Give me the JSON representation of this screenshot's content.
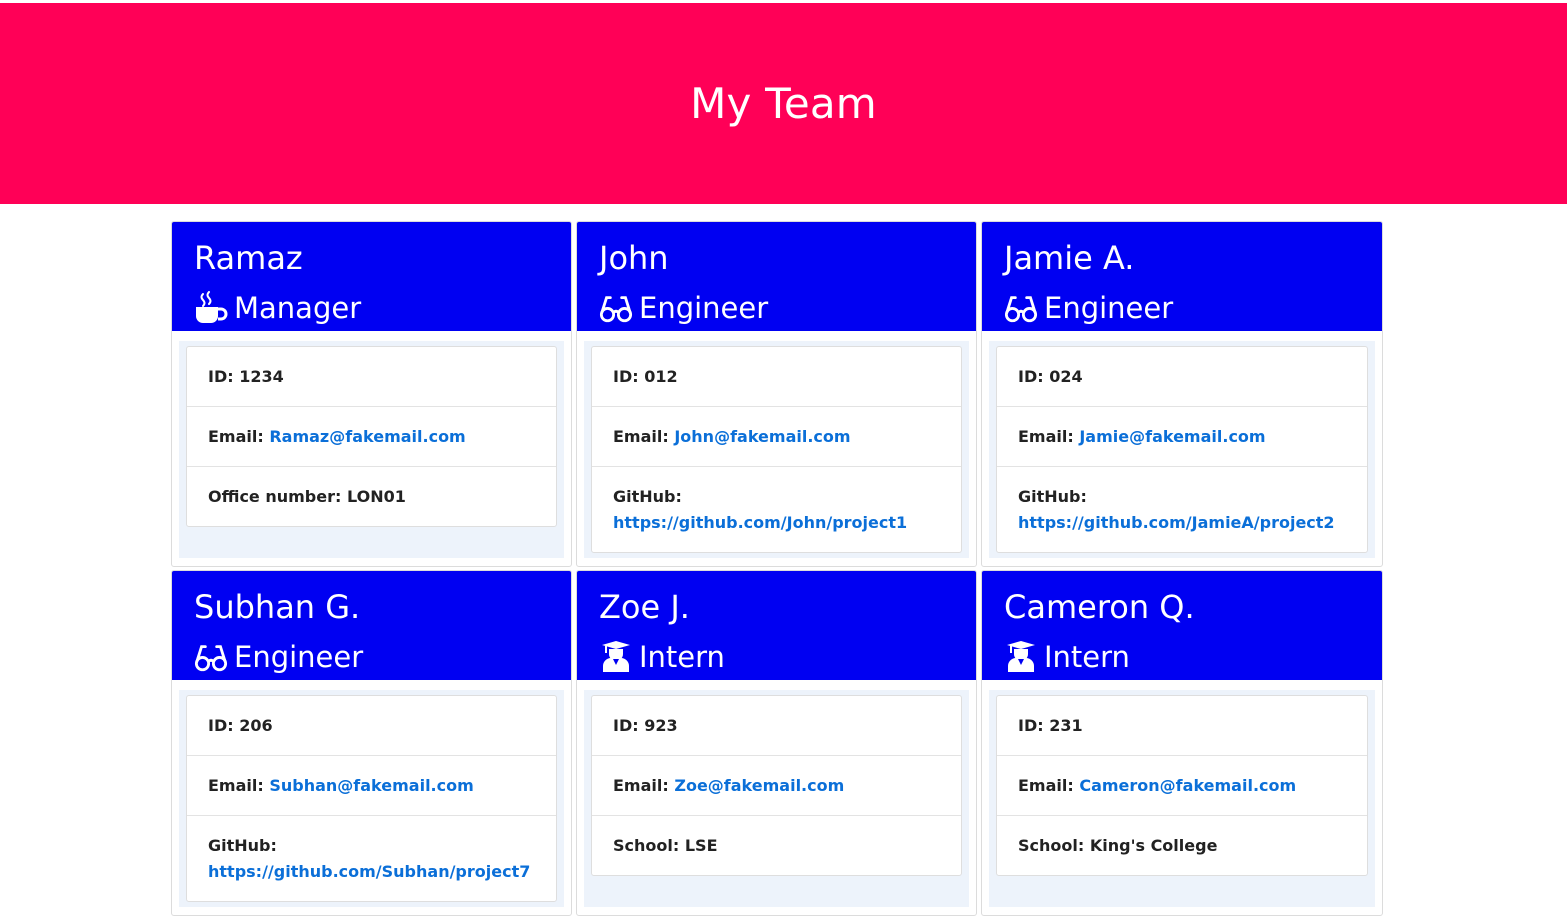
{
  "header": {
    "title": "My Team"
  },
  "labels": {
    "id": "ID: ",
    "email": "Email: ",
    "office": "Office number: ",
    "github": "GitHub:",
    "school": "School: "
  },
  "icons": {
    "manager": "coffee-mug-icon",
    "engineer": "glasses-icon",
    "intern": "graduate-icon"
  },
  "colors": {
    "header_bg": "#ff0057",
    "card_header_bg": "#0000f2",
    "link": "#0b6fd8"
  },
  "employees": [
    {
      "name": "Ramaz",
      "role": "Manager",
      "id": "1234",
      "email": "Ramaz@fakemail.com",
      "office": "LON01"
    },
    {
      "name": "John",
      "role": "Engineer",
      "id": "012",
      "email": "John@fakemail.com",
      "github": "https://github.com/John/project1"
    },
    {
      "name": "Jamie A.",
      "role": "Engineer",
      "id": "024",
      "email": "Jamie@fakemail.com",
      "github": "https://github.com/JamieA/project2"
    },
    {
      "name": "Subhan G.",
      "role": "Engineer",
      "id": "206",
      "email": "Subhan@fakemail.com",
      "github": "https://github.com/Subhan/project7"
    },
    {
      "name": "Zoe J.",
      "role": "Intern",
      "id": "923",
      "email": "Zoe@fakemail.com",
      "school": "LSE"
    },
    {
      "name": "Cameron Q.",
      "role": "Intern",
      "id": "231",
      "email": "Cameron@fakemail.com",
      "school": "King's College"
    }
  ]
}
